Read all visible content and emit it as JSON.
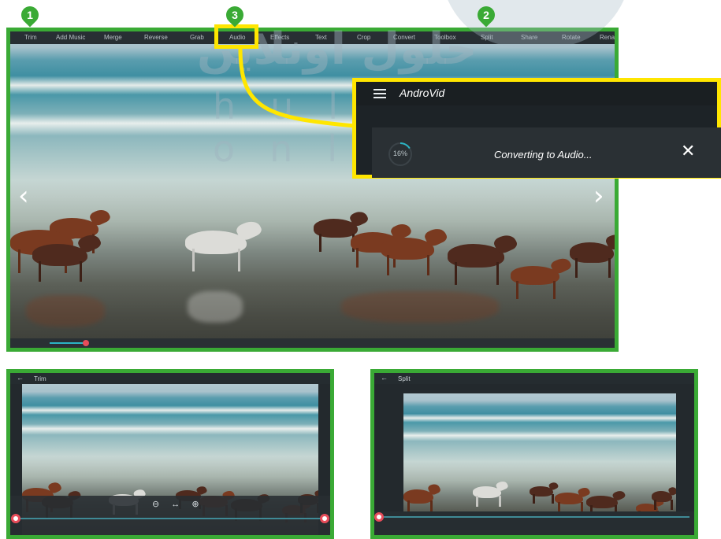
{
  "watermark": {
    "arabic": "حلول اونلاين",
    "latin": "hulul online"
  },
  "badges": [
    "1",
    "3",
    "2"
  ],
  "main": {
    "toolbar": [
      "Trim",
      "Add Music",
      "Merge",
      "Reverse",
      "Grab",
      "Audio",
      "Effects",
      "Text",
      "Crop",
      "Convert",
      "Toolbox",
      "Split",
      "Share",
      "Rotate",
      "Rena"
    ],
    "highlighted_tool": "Audio",
    "nav_prev": "‹",
    "nav_next": "›"
  },
  "popup": {
    "app_name": "AndroVid",
    "progress_label": "16%",
    "progress_value": 0.16,
    "status": "Converting to Audio...",
    "close": "✕"
  },
  "trim": {
    "back": "←",
    "title": "Trim",
    "zoom_controls": "⊖ ↔ ⊕"
  },
  "split": {
    "back": "←",
    "title": "Split"
  },
  "colors": {
    "frame": "#3aaa35",
    "highlight": "#ffe600",
    "progress": "#2bb5c5",
    "thumb": "#e74c5a"
  }
}
